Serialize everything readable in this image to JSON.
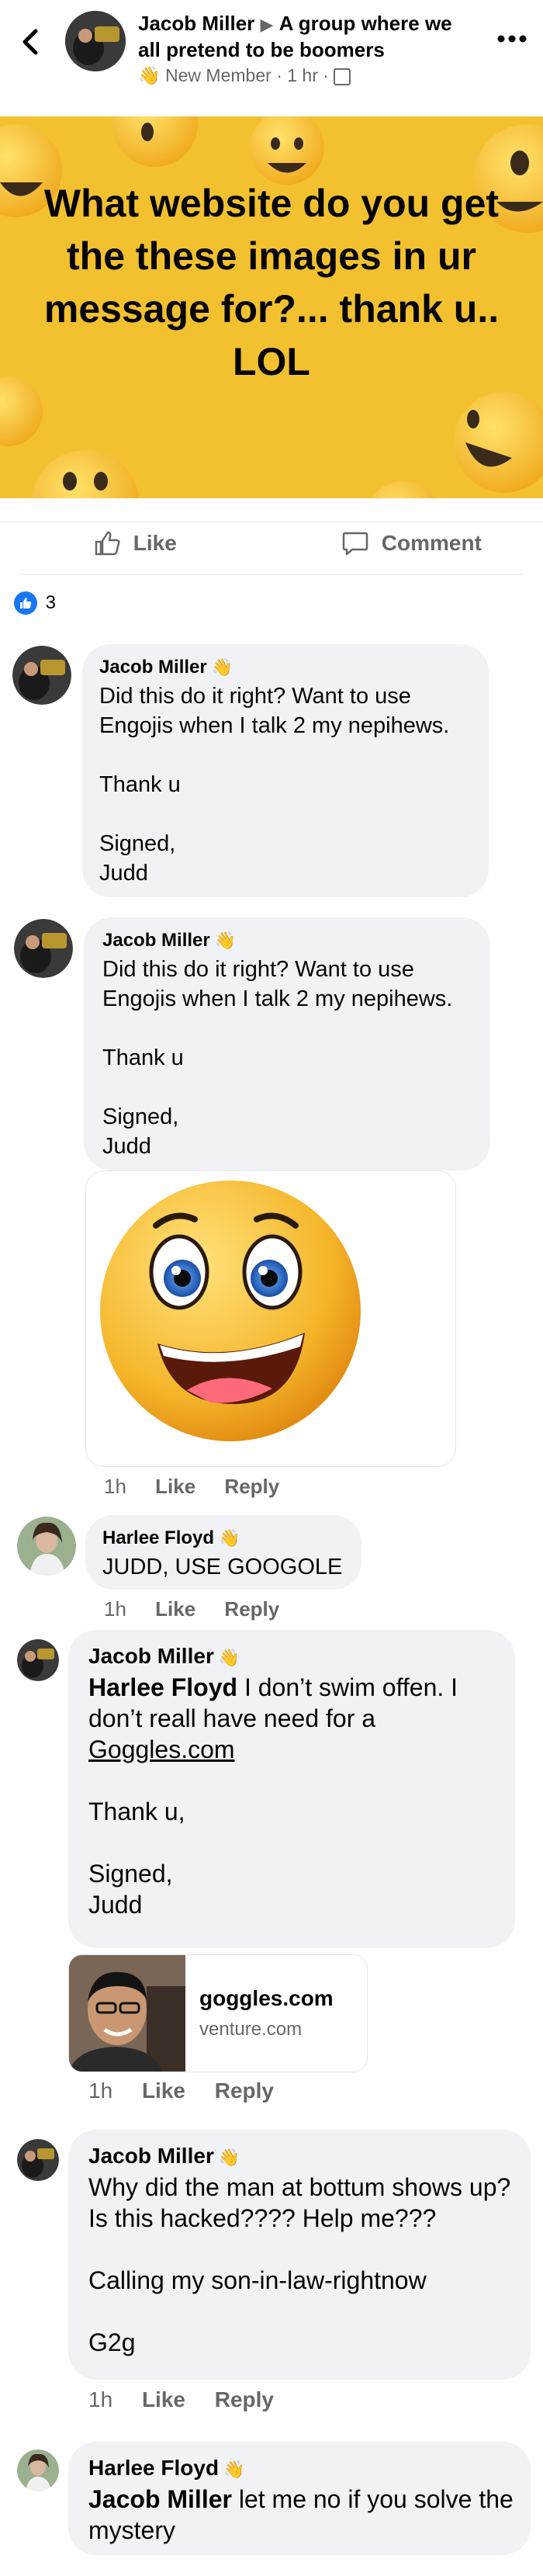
{
  "header": {
    "author": "Jacob Miller",
    "group": "A group where we all pretend to be boomers",
    "badge": "New Member",
    "time": "1 hr"
  },
  "post": {
    "text": "What website do you get the these images in ur message for?... thank u.. LOL",
    "bg_color": "#f3c12f"
  },
  "actions": {
    "like": "Like",
    "comment": "Comment"
  },
  "reactions": {
    "count": "3"
  },
  "comments": [
    {
      "author": "Jacob Miller",
      "text": "Did this do it right? Want to use Engojis when I talk 2 my nepihews.\n\nThank u\n\nSigned,\nJudd"
    },
    {
      "author": "Jacob Miller",
      "text": "Did this do it right? Want to use Engojis when I talk 2 my nepihews.\n\nThank u\n\nSigned,\nJudd",
      "meta": {
        "time": "1h",
        "like": "Like",
        "reply": "Reply"
      }
    },
    {
      "author": "Harlee Floyd",
      "text": "JUDD, USE GOOGOLE",
      "meta": {
        "time": "1h",
        "like": "Like",
        "reply": "Reply"
      }
    },
    {
      "author": "Jacob Miller",
      "mention": "Harlee Floyd",
      "text_a": " I don’t swim offen. I don’t reall have need for a ",
      "link": "Goggles.com",
      "text_b": "\n\nThank u,\n\nSigned,\nJudd",
      "preview": {
        "title": "goggles.com",
        "domain": "venture.com"
      },
      "meta": {
        "time": "1h",
        "like": "Like",
        "reply": "Reply"
      }
    },
    {
      "author": "Jacob Miller",
      "text": "Why did the man at bottum shows up? Is this hacked???? Help me???\n\nCalling my son-in-law-rightnow\n\nG2g",
      "meta": {
        "time": "1h",
        "like": "Like",
        "reply": "Reply"
      }
    },
    {
      "author": "Harlee Floyd",
      "mention": "Jacob Miller",
      "text": " let me no if you solve the mystery"
    }
  ]
}
